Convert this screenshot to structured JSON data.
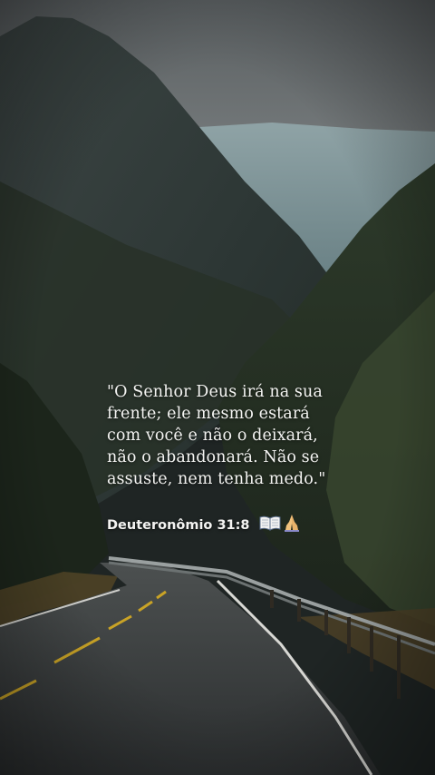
{
  "verse": {
    "text": "\"O Senhor Deus irá na sua\nfrente; ele mesmo estará\ncom você e não o deixará,\nnão o abandonará. Não se\nassuste, nem tenha medo.\"",
    "reference": "Deuteronômio 31:8"
  },
  "icons": [
    "open-book-icon",
    "praying-hands-icon"
  ]
}
